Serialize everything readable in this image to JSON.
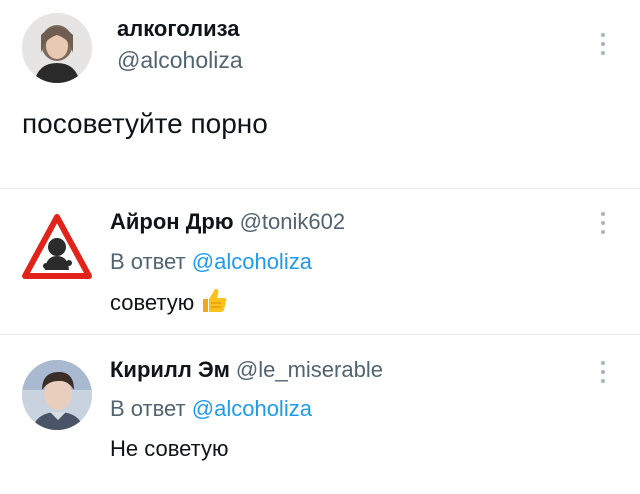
{
  "main_tweet": {
    "author_name": "алкоголиза",
    "author_handle": "@alcoholiza",
    "text": "посоветуйте порно"
  },
  "replies": [
    {
      "author_name": "Айрон Дрю",
      "author_handle": "@tonik602",
      "reply_prefix": "В ответ",
      "reply_to": "@alcoholiza",
      "text": "советую",
      "emoji": "👍"
    },
    {
      "author_name": "Кирилл Эм",
      "author_handle": "@le_miserable",
      "reply_prefix": "В ответ",
      "reply_to": "@alcoholiza",
      "text": "Не советую"
    }
  ],
  "icons": {
    "more": "more-vertical-icon",
    "thumbs_up": "thumbs-up-emoji",
    "warning_avatar": "warning-triangle-avatar"
  },
  "colors": {
    "link": "#1d9bf0",
    "secondary_text": "#536471",
    "divider": "#e7e9ea"
  }
}
